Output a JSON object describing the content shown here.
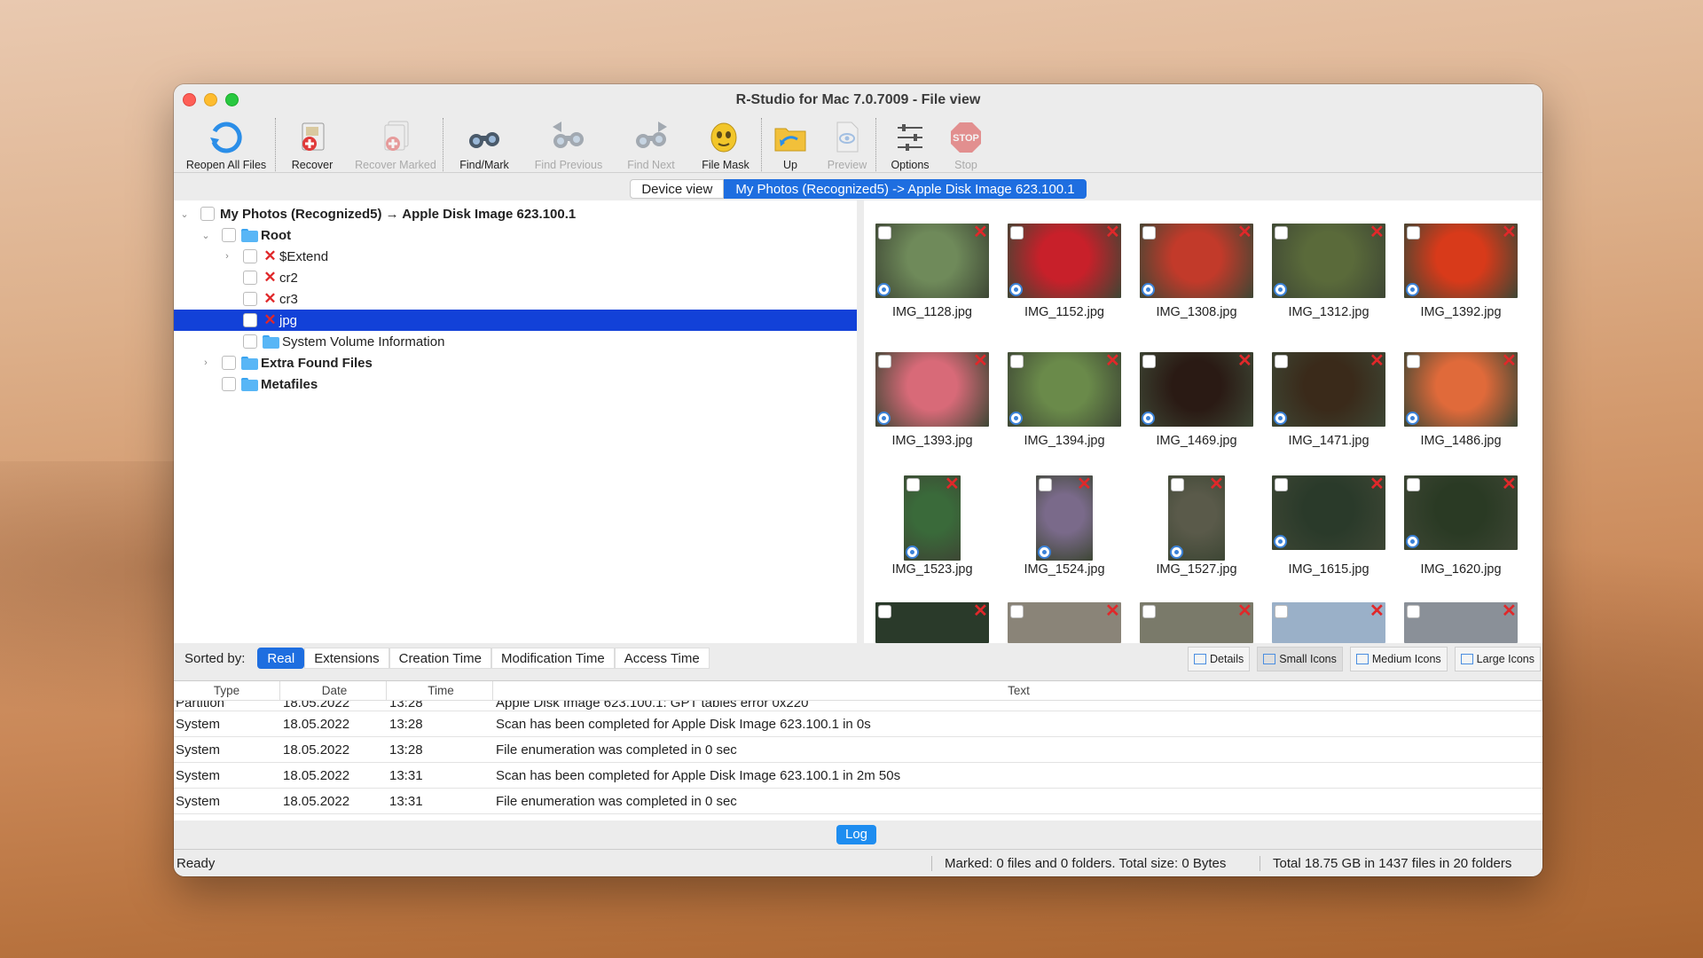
{
  "window": {
    "title": "R-Studio for Mac 7.0.7009 - File view"
  },
  "toolbar": {
    "reopen": "Reopen All Files",
    "recover": "Recover",
    "recover_marked": "Recover Marked",
    "find_mark": "Find/Mark",
    "find_previous": "Find Previous",
    "find_next": "Find Next",
    "file_mask": "File Mask",
    "up": "Up",
    "preview": "Preview",
    "options": "Options",
    "stop": "Stop",
    "stop_glyph": "STOP"
  },
  "tabs": {
    "device_view": "Device view",
    "current": "My Photos (Recognized5) -> Apple Disk Image 623.100.1"
  },
  "tree": {
    "root_label": "My Photos (Recognized5) → Apple Disk Image 623.100.1",
    "items": [
      {
        "label": "Root"
      },
      {
        "label": "$Extend"
      },
      {
        "label": "cr2"
      },
      {
        "label": "cr3"
      },
      {
        "label": "jpg"
      },
      {
        "label": "System Volume Information"
      },
      {
        "label": "Extra Found Files"
      },
      {
        "label": "Metafiles"
      }
    ]
  },
  "thumbnails": [
    {
      "name": "IMG_1128.jpg",
      "color": "#6f8a5a"
    },
    {
      "name": "IMG_1152.jpg",
      "color": "#c8202a"
    },
    {
      "name": "IMG_1308.jpg",
      "color": "#c23a2a"
    },
    {
      "name": "IMG_1312.jpg",
      "color": "#5a6a3a"
    },
    {
      "name": "IMG_1392.jpg",
      "color": "#d83a1a"
    },
    {
      "name": "IMG_1393.jpg",
      "color": "#d86a78"
    },
    {
      "name": "IMG_1394.jpg",
      "color": "#6a8a4a"
    },
    {
      "name": "IMG_1469.jpg",
      "color": "#2a1a14"
    },
    {
      "name": "IMG_1471.jpg",
      "color": "#3a2a1a"
    },
    {
      "name": "IMG_1486.jpg",
      "color": "#e06a3a"
    },
    {
      "name": "IMG_1523.jpg",
      "color": "#3a6a3a"
    },
    {
      "name": "IMG_1524.jpg",
      "color": "#7a6a8a"
    },
    {
      "name": "IMG_1527.jpg",
      "color": "#5a5a4a"
    },
    {
      "name": "IMG_1615.jpg",
      "color": "#2a3a2a"
    },
    {
      "name": "IMG_1620.jpg",
      "color": "#2a3a24"
    }
  ],
  "partial_row_colors": [
    "#2a3a2a",
    "#8a8478",
    "#7a7a6a",
    "#9ab0c8",
    "#8a9098"
  ],
  "sort": {
    "label": "Sorted by:",
    "options": [
      "Real",
      "Extensions",
      "Creation Time",
      "Modification Time",
      "Access Time"
    ]
  },
  "views": {
    "details": "Details",
    "small": "Small Icons",
    "medium": "Medium Icons",
    "large": "Large Icons"
  },
  "log": {
    "headers": [
      "Type",
      "Date",
      "Time",
      "Text"
    ],
    "rows": [
      [
        "Partition",
        "18.05.2022",
        "13:28",
        "Apple Disk Image 623.100.1: GPT tables error 0x220"
      ],
      [
        "System",
        "18.05.2022",
        "13:28",
        "Scan has been completed for Apple Disk Image 623.100.1 in 0s"
      ],
      [
        "System",
        "18.05.2022",
        "13:28",
        "File enumeration was completed in 0 sec"
      ],
      [
        "System",
        "18.05.2022",
        "13:31",
        "Scan has been completed for Apple Disk Image 623.100.1 in 2m 50s"
      ],
      [
        "System",
        "18.05.2022",
        "13:31",
        "File enumeration was completed in 0 sec"
      ]
    ],
    "button": "Log"
  },
  "status": {
    "state": "Ready",
    "marked": "Marked: 0 files and 0 folders. Total size: 0 Bytes",
    "total": "Total 18.75 GB in 1437 files in 20 folders"
  }
}
